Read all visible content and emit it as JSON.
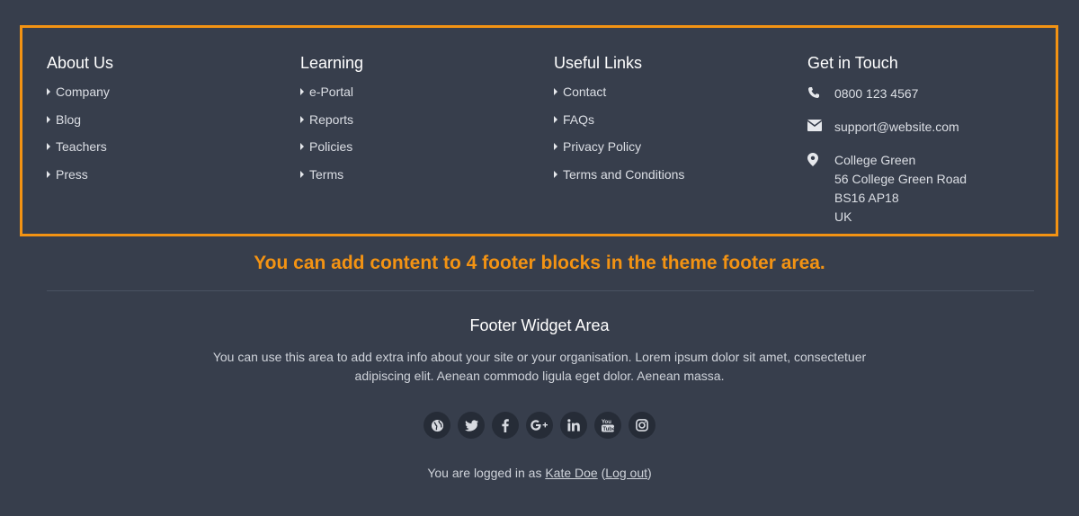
{
  "footer_blocks": [
    {
      "title": "About Us",
      "links": [
        "Company",
        "Blog",
        "Teachers",
        "Press"
      ]
    },
    {
      "title": "Learning",
      "links": [
        "e-Portal",
        "Reports",
        "Policies",
        "Terms"
      ]
    },
    {
      "title": "Useful Links",
      "links": [
        "Contact",
        "FAQs",
        "Privacy Policy",
        "Terms and Conditions"
      ]
    }
  ],
  "contact": {
    "title": "Get in Touch",
    "phone": "0800 123 4567",
    "email": "support@website.com",
    "address": [
      "College Green",
      "56 College Green Road",
      "BS16 AP18",
      "UK"
    ]
  },
  "callout": "You can add content to 4 footer blocks in the theme footer area.",
  "widget": {
    "title": "Footer Widget Area",
    "text": "You can use this area to add extra info about your site or your organisation. Lorem ipsum dolor sit amet, consectetuer adipiscing elit. Aenean commodo ligula eget dolor. Aenean massa."
  },
  "social_icons": [
    "globe-icon",
    "twitter-icon",
    "facebook-icon",
    "google-plus-icon",
    "linkedin-icon",
    "youtube-icon",
    "instagram-icon"
  ],
  "login": {
    "prefix": "You are logged in as ",
    "user": "Kate Doe",
    "open": " (",
    "logout": "Log out",
    "close": ")"
  },
  "colors": {
    "background": "#373e4c",
    "accent": "#f39313",
    "social_bg": "#262c37"
  }
}
